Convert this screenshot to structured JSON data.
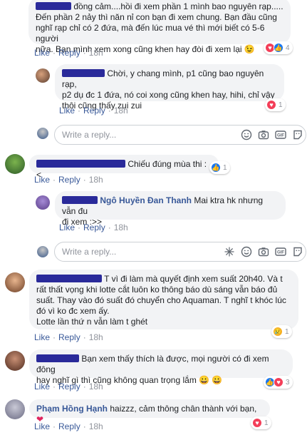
{
  "like_label": "Like",
  "reply_label": "Reply",
  "comments": [
    {
      "text_lines": [
        "đồng cảm....hồi đi xem phần 1 mình bao nguyên rạp.....",
        "Đến phần 2 nảy thì năn nỉ con bạn đi xem chung. Bạn đầu cũng",
        "nghĩ rạp chỉ có 2 đứa, mà đến lúc mua vé thì mới biết có 5-6 người",
        "nữa. Bạn mình xem xong cũng khen hay đòi đi xem lại 😉"
      ],
      "time": "18h",
      "reaction_count": "4"
    },
    {
      "text_lines": [
        "Chời, y chang mình, p1 cũng bao nguyên rạp,",
        "p2 dụ đc 1 đứa, nó coi xong cũng khen hay, hihi, chỉ vậy",
        "thôi cũng thấy zui zui"
      ],
      "time": "18h",
      "reaction_count": "1"
    },
    {
      "text": "Chiếu đúng mùa thi :<",
      "time": "18h",
      "reaction_count": "1"
    },
    {
      "name": "Ngô Huyền Đan Thanh",
      "text_lines": [
        "Mai ktra hk nhưng vẫn đu",
        "đi xem :>>"
      ],
      "time": "18h"
    },
    {
      "text_lines": [
        "T vì đi làm mà quyết định xem suất 20h40. Và t",
        "rất thất vọng khi lotte cắt luôn ko thông báo dù sáng vẫn báo đủ",
        "suất. Thay vào đó suất đó chuyển cho Aquaman. T nghĩ t khóc lúc",
        "đó vì ko đc xem ấy.",
        "Lotte lần thứ n vẫn làm t ghét"
      ],
      "time": "18h",
      "reaction_count": "1"
    },
    {
      "text_lines": [
        "Bạn xem thấy thích là được, mọi người có đi xem đông",
        "hay nghĩ gì thì cũng không quan trọng lắm 😀 😀"
      ],
      "time": "18h",
      "reaction_count": "3"
    },
    {
      "name": "Phạm Hồng Hạnh",
      "text": "haizzz, cảm thông chân thành với bạn,",
      "time": "18h",
      "reaction_count": "1"
    }
  ],
  "reply_boxes": [
    {
      "placeholder": "Write a reply..."
    },
    {
      "placeholder": "Write a reply..."
    }
  ],
  "colors": {
    "link": "#385898",
    "meta": "#90949c",
    "bubble": "#f2f3f5",
    "like": "#1877f2",
    "heart": "#f33e58"
  }
}
